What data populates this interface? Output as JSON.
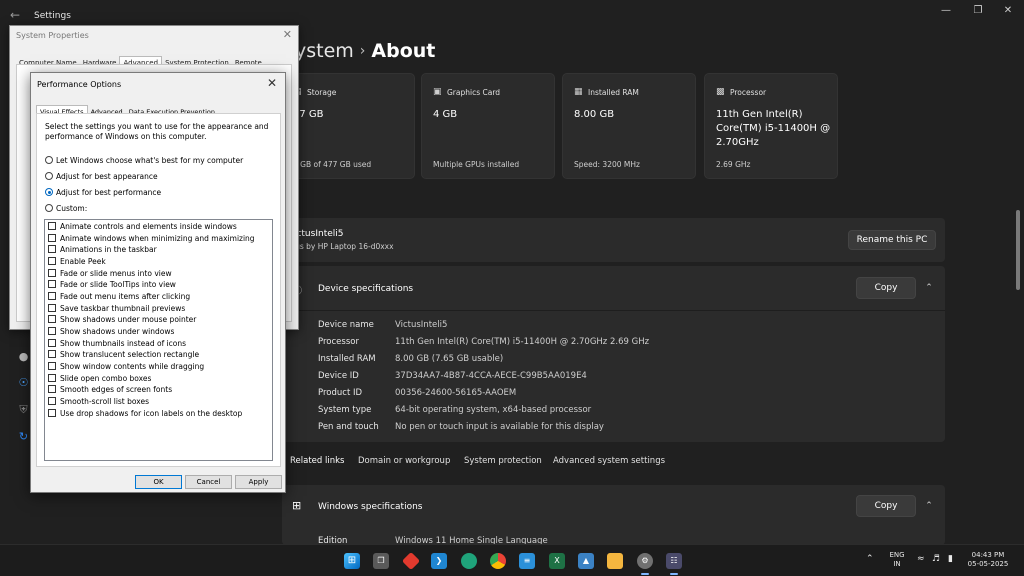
{
  "settings": {
    "app_title": "Settings",
    "heading_parent": "ystem",
    "heading_current": "About",
    "cards": [
      {
        "label": "Storage",
        "value": "77 GB",
        "sub": "4 GB of 477 GB used",
        "icon": "storage-icon"
      },
      {
        "label": "Graphics Card",
        "value": "4 GB",
        "sub": "Multiple GPUs installed",
        "icon": "graphics-card-icon"
      },
      {
        "label": "Installed RAM",
        "value": "8.00 GB",
        "sub": "Speed: 3200 MHz",
        "icon": "ram-icon"
      },
      {
        "label": "Processor",
        "value": "11th Gen Intel(R) Core(TM) i5-11400H @ 2.70GHz",
        "sub": "2.69 GHz",
        "icon": "processor-icon"
      }
    ],
    "pc_name": "VictusInteli5",
    "pc_model": "ctus by HP Laptop 16-d0xxx",
    "rename_label": "Rename this PC",
    "device_specs_title": "Device specifications",
    "copy_label": "Copy",
    "device_specs": [
      {
        "label": "Device name",
        "value": "VictusInteli5"
      },
      {
        "label": "Processor",
        "value": "11th Gen Intel(R) Core(TM) i5-11400H @ 2.70GHz   2.69 GHz"
      },
      {
        "label": "Installed RAM",
        "value": "8.00 GB (7.65 GB usable)"
      },
      {
        "label": "Device ID",
        "value": "37D34AA7-4B87-4CCA-AECE-C99B5AA019E4"
      },
      {
        "label": "Product ID",
        "value": "00356-24600-56165-AAOEM"
      },
      {
        "label": "System type",
        "value": "64-bit operating system, x64-based processor"
      },
      {
        "label": "Pen and touch",
        "value": "No pen or touch input is available for this display"
      }
    ],
    "related_links_label": "Related links",
    "related_links": [
      "Domain or workgroup",
      "System protection",
      "Advanced system settings"
    ],
    "windows_specs_title": "Windows specifications",
    "edition_label": "Edition",
    "edition_value": "Windows 11 Home Single Language"
  },
  "system_properties": {
    "title": "System Properties",
    "tabs": [
      "Computer Name",
      "Hardware",
      "Advanced",
      "System Protection",
      "Remote"
    ],
    "active_tab": "Advanced"
  },
  "performance_options": {
    "title": "Performance Options",
    "tabs": [
      "Visual Effects",
      "Advanced",
      "Data Execution Prevention"
    ],
    "active_tab": "Visual Effects",
    "description": "Select the settings you want to use for the appearance and performance of Windows on this computer.",
    "radio_options": [
      {
        "label": "Let Windows choose what's best for my computer",
        "checked": false
      },
      {
        "label": "Adjust for best appearance",
        "checked": false
      },
      {
        "label": "Adjust for best performance",
        "checked": true
      },
      {
        "label": "Custom:",
        "checked": false
      }
    ],
    "effects": [
      "Animate controls and elements inside windows",
      "Animate windows when minimizing and maximizing",
      "Animations in the taskbar",
      "Enable Peek",
      "Fade or slide menus into view",
      "Fade or slide ToolTips into view",
      "Fade out menu items after clicking",
      "Save taskbar thumbnail previews",
      "Show shadows under mouse pointer",
      "Show shadows under windows",
      "Show thumbnails instead of icons",
      "Show translucent selection rectangle",
      "Show window contents while dragging",
      "Slide open combo boxes",
      "Smooth edges of screen fonts",
      "Smooth-scroll list boxes",
      "Use drop shadows for icon labels on the desktop"
    ],
    "ok_label": "OK",
    "cancel_label": "Cancel",
    "apply_label": "Apply"
  },
  "taskbar": {
    "lang_top": "ENG",
    "lang_bottom": "IN",
    "time": "04:43 PM",
    "date": "05-05-2025"
  },
  "colors": {
    "accent": "#0067c0",
    "settings_bg": "#202020",
    "card_bg": "#2b2b2b"
  }
}
